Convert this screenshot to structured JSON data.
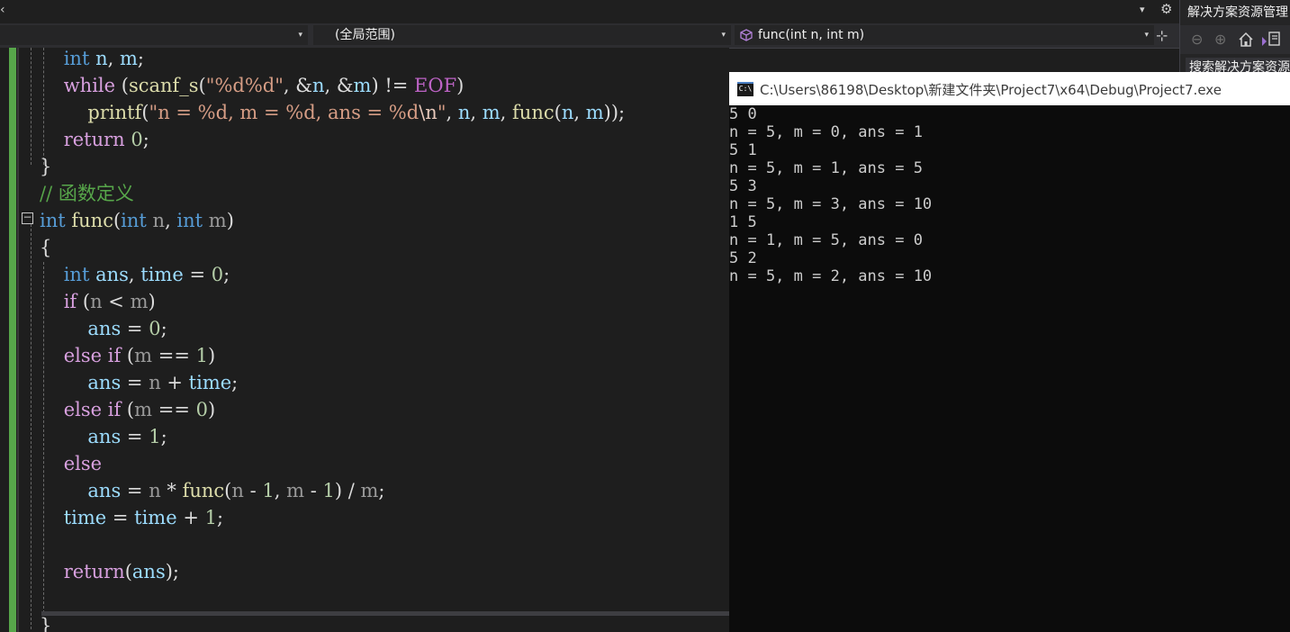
{
  "topbar": {
    "left_chevron": "‹",
    "dropdown_arrow": "▾",
    "gear": "⚙"
  },
  "navbar": {
    "project_dropdown": {
      "label": "",
      "arrow": "▾"
    },
    "scope_dropdown": {
      "label": "(全局范围)",
      "arrow": "▾"
    },
    "member_dropdown": {
      "label": "func(int n, int m)",
      "arrow": "▾"
    },
    "split_button": "⊹"
  },
  "solution_explorer": {
    "title": "解决方案资源管理",
    "search_placeholder": "搜索解决方案资源",
    "toolbar": [
      "back",
      "forward",
      "home",
      "switch-views"
    ]
  },
  "editor": {
    "fold_glyph": "−",
    "lines": [
      {
        "segments": [
          {
            "t": "    "
          },
          {
            "t": "int",
            "c": "kw"
          },
          {
            "t": " n",
            "c": "var"
          },
          {
            "t": ", "
          },
          {
            "t": "m",
            "c": "var"
          },
          {
            "t": ";"
          }
        ]
      },
      {
        "segments": [
          {
            "t": "    "
          },
          {
            "t": "while",
            "c": "ctl"
          },
          {
            "t": " ("
          },
          {
            "t": "scanf_s",
            "c": "fn"
          },
          {
            "t": "("
          },
          {
            "t": "\"%d%d\"",
            "c": "str"
          },
          {
            "t": ", &"
          },
          {
            "t": "n",
            "c": "var"
          },
          {
            "t": ", &"
          },
          {
            "t": "m",
            "c": "var"
          },
          {
            "t": ") != "
          },
          {
            "t": "EOF",
            "c": "mac"
          },
          {
            "t": ")"
          }
        ]
      },
      {
        "segments": [
          {
            "t": "        "
          },
          {
            "t": "printf",
            "c": "fn"
          },
          {
            "t": "("
          },
          {
            "t": "\"n = %d, m = %d, ans = %d",
            "c": "str"
          },
          {
            "t": "\\n",
            "c": "esc"
          },
          {
            "t": "\"",
            "c": "str"
          },
          {
            "t": ", "
          },
          {
            "t": "n",
            "c": "var"
          },
          {
            "t": ", "
          },
          {
            "t": "m",
            "c": "var"
          },
          {
            "t": ", "
          },
          {
            "t": "func",
            "c": "fn"
          },
          {
            "t": "("
          },
          {
            "t": "n",
            "c": "var"
          },
          {
            "t": ", "
          },
          {
            "t": "m",
            "c": "var"
          },
          {
            "t": "));"
          }
        ]
      },
      {
        "segments": [
          {
            "t": "    "
          },
          {
            "t": "return",
            "c": "ctl"
          },
          {
            "t": " "
          },
          {
            "t": "0",
            "c": "num"
          },
          {
            "t": ";"
          }
        ]
      },
      {
        "segments": [
          {
            "t": "}"
          }
        ]
      },
      {
        "segments": [
          {
            "t": "// 函数定义",
            "c": "cmt"
          }
        ]
      },
      {
        "segments": [
          {
            "t": "int",
            "c": "kw"
          },
          {
            "t": " "
          },
          {
            "t": "func",
            "c": "fn"
          },
          {
            "t": "("
          },
          {
            "t": "int",
            "c": "kw"
          },
          {
            "t": " n",
            "c": "par"
          },
          {
            "t": ", "
          },
          {
            "t": "int",
            "c": "kw"
          },
          {
            "t": " m",
            "c": "par"
          },
          {
            "t": ")"
          }
        ]
      },
      {
        "segments": [
          {
            "t": "{"
          }
        ]
      },
      {
        "segments": [
          {
            "t": "    "
          },
          {
            "t": "int",
            "c": "kw"
          },
          {
            "t": " "
          },
          {
            "t": "ans",
            "c": "var"
          },
          {
            "t": ", "
          },
          {
            "t": "time",
            "c": "var"
          },
          {
            "t": " = "
          },
          {
            "t": "0",
            "c": "num"
          },
          {
            "t": ";"
          }
        ]
      },
      {
        "segments": [
          {
            "t": "    "
          },
          {
            "t": "if",
            "c": "ctl"
          },
          {
            "t": " ("
          },
          {
            "t": "n",
            "c": "par"
          },
          {
            "t": " < "
          },
          {
            "t": "m",
            "c": "par"
          },
          {
            "t": ")"
          }
        ]
      },
      {
        "segments": [
          {
            "t": "        "
          },
          {
            "t": "ans",
            "c": "var"
          },
          {
            "t": " = "
          },
          {
            "t": "0",
            "c": "num"
          },
          {
            "t": ";"
          }
        ]
      },
      {
        "segments": [
          {
            "t": "    "
          },
          {
            "t": "else",
            "c": "ctl"
          },
          {
            "t": " "
          },
          {
            "t": "if",
            "c": "ctl"
          },
          {
            "t": " ("
          },
          {
            "t": "m",
            "c": "par"
          },
          {
            "t": " == "
          },
          {
            "t": "1",
            "c": "num"
          },
          {
            "t": ")"
          }
        ]
      },
      {
        "segments": [
          {
            "t": "        "
          },
          {
            "t": "ans",
            "c": "var"
          },
          {
            "t": " = "
          },
          {
            "t": "n",
            "c": "par"
          },
          {
            "t": " + "
          },
          {
            "t": "time",
            "c": "var"
          },
          {
            "t": ";"
          }
        ]
      },
      {
        "segments": [
          {
            "t": "    "
          },
          {
            "t": "else",
            "c": "ctl"
          },
          {
            "t": " "
          },
          {
            "t": "if",
            "c": "ctl"
          },
          {
            "t": " ("
          },
          {
            "t": "m",
            "c": "par"
          },
          {
            "t": " == "
          },
          {
            "t": "0",
            "c": "num"
          },
          {
            "t": ")"
          }
        ]
      },
      {
        "segments": [
          {
            "t": "        "
          },
          {
            "t": "ans",
            "c": "var"
          },
          {
            "t": " = "
          },
          {
            "t": "1",
            "c": "num"
          },
          {
            "t": ";"
          }
        ]
      },
      {
        "segments": [
          {
            "t": "    "
          },
          {
            "t": "else",
            "c": "ctl"
          }
        ]
      },
      {
        "segments": [
          {
            "t": "        "
          },
          {
            "t": "ans",
            "c": "var"
          },
          {
            "t": " = "
          },
          {
            "t": "n",
            "c": "par"
          },
          {
            "t": " * "
          },
          {
            "t": "func",
            "c": "fn"
          },
          {
            "t": "("
          },
          {
            "t": "n",
            "c": "par"
          },
          {
            "t": " - "
          },
          {
            "t": "1",
            "c": "num"
          },
          {
            "t": ", "
          },
          {
            "t": "m",
            "c": "par"
          },
          {
            "t": " - "
          },
          {
            "t": "1",
            "c": "num"
          },
          {
            "t": ") / "
          },
          {
            "t": "m",
            "c": "par"
          },
          {
            "t": ";"
          }
        ]
      },
      {
        "segments": [
          {
            "t": "    "
          },
          {
            "t": "time",
            "c": "var"
          },
          {
            "t": " = "
          },
          {
            "t": "time",
            "c": "var"
          },
          {
            "t": " + "
          },
          {
            "t": "1",
            "c": "num"
          },
          {
            "t": ";"
          }
        ]
      },
      {
        "segments": [
          {
            "t": ""
          }
        ]
      },
      {
        "segments": [
          {
            "t": "    "
          },
          {
            "t": "return",
            "c": "ctl"
          },
          {
            "t": "("
          },
          {
            "t": "ans",
            "c": "var"
          },
          {
            "t": ");"
          }
        ]
      },
      {
        "segments": [
          {
            "t": ""
          }
        ]
      },
      {
        "segments": [
          {
            "t": "}"
          }
        ]
      }
    ]
  },
  "console": {
    "icon_text": "C:\\",
    "title": "C:\\Users\\86198\\Desktop\\新建文件夹\\Project7\\x64\\Debug\\Project7.exe",
    "output_lines": [
      "5 0",
      "n = 5, m = 0, ans = 1",
      "5 1",
      "n = 5, m = 1, ans = 5",
      "5 3",
      "n = 5, m = 3, ans = 10",
      "1 5",
      "n = 1, m = 5, ans = 0",
      "5 2",
      "n = 5, m = 2, ans = 10"
    ]
  }
}
